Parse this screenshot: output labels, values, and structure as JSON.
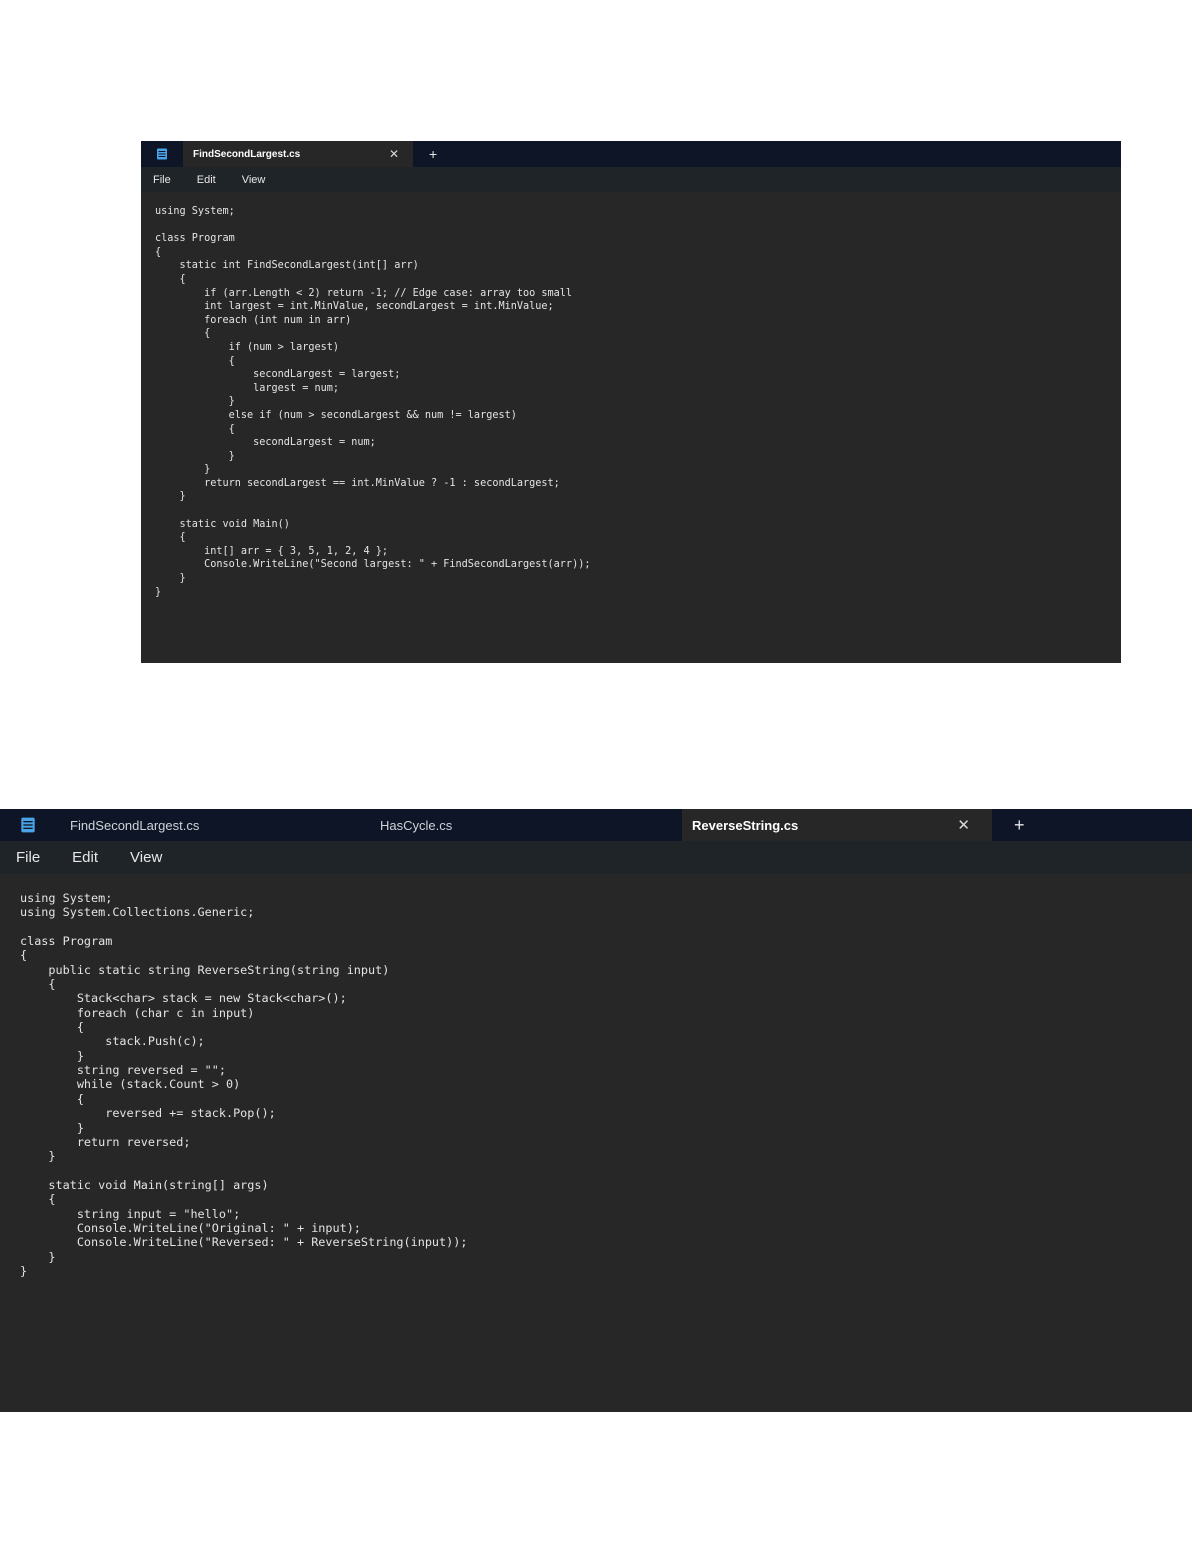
{
  "window1": {
    "tabs": [
      {
        "label": "FindSecondLargest.cs",
        "active": true
      }
    ],
    "close_glyph": "✕",
    "new_tab_glyph": "+",
    "menu": [
      "File",
      "Edit",
      "View"
    ],
    "code": "using System;\n\nclass Program\n{\n    static int FindSecondLargest(int[] arr)\n    {\n        if (arr.Length < 2) return -1; // Edge case: array too small\n        int largest = int.MinValue, secondLargest = int.MinValue;\n        foreach (int num in arr)\n        {\n            if (num > largest)\n            {\n                secondLargest = largest;\n                largest = num;\n            }\n            else if (num > secondLargest && num != largest)\n            {\n                secondLargest = num;\n            }\n        }\n        return secondLargest == int.MinValue ? -1 : secondLargest;\n    }\n\n    static void Main()\n    {\n        int[] arr = { 3, 5, 1, 2, 4 };\n        Console.WriteLine(\"Second largest: \" + FindSecondLargest(arr));\n    }\n}"
  },
  "window2": {
    "tabs": [
      {
        "label": "FindSecondLargest.cs",
        "active": false
      },
      {
        "label": "HasCycle.cs",
        "active": false
      },
      {
        "label": "ReverseString.cs",
        "active": true
      }
    ],
    "close_glyph": "✕",
    "new_tab_glyph": "+",
    "menu": [
      "File",
      "Edit",
      "View"
    ],
    "code": "using System;\nusing System.Collections.Generic;\n\nclass Program\n{\n    public static string ReverseString(string input)\n    {\n        Stack<char> stack = new Stack<char>();\n        foreach (char c in input)\n        {\n            stack.Push(c);\n        }\n        string reversed = \"\";\n        while (stack.Count > 0)\n        {\n            reversed += stack.Pop();\n        }\n        return reversed;\n    }\n\n    static void Main(string[] args)\n    {\n        string input = \"hello\";\n        Console.WriteLine(\"Original: \" + input);\n        Console.WriteLine(\"Reversed: \" + ReverseString(input));\n    }\n}"
  },
  "icons": {
    "app": "notepad-icon",
    "close": "close-icon",
    "add": "plus-icon"
  },
  "colors": {
    "tabbar_bg": "#0d1526",
    "menubar_bg": "#1f2428",
    "editor_bg": "#272727",
    "text": "#e4e4e4",
    "icon_accent": "#4aa3e8"
  }
}
